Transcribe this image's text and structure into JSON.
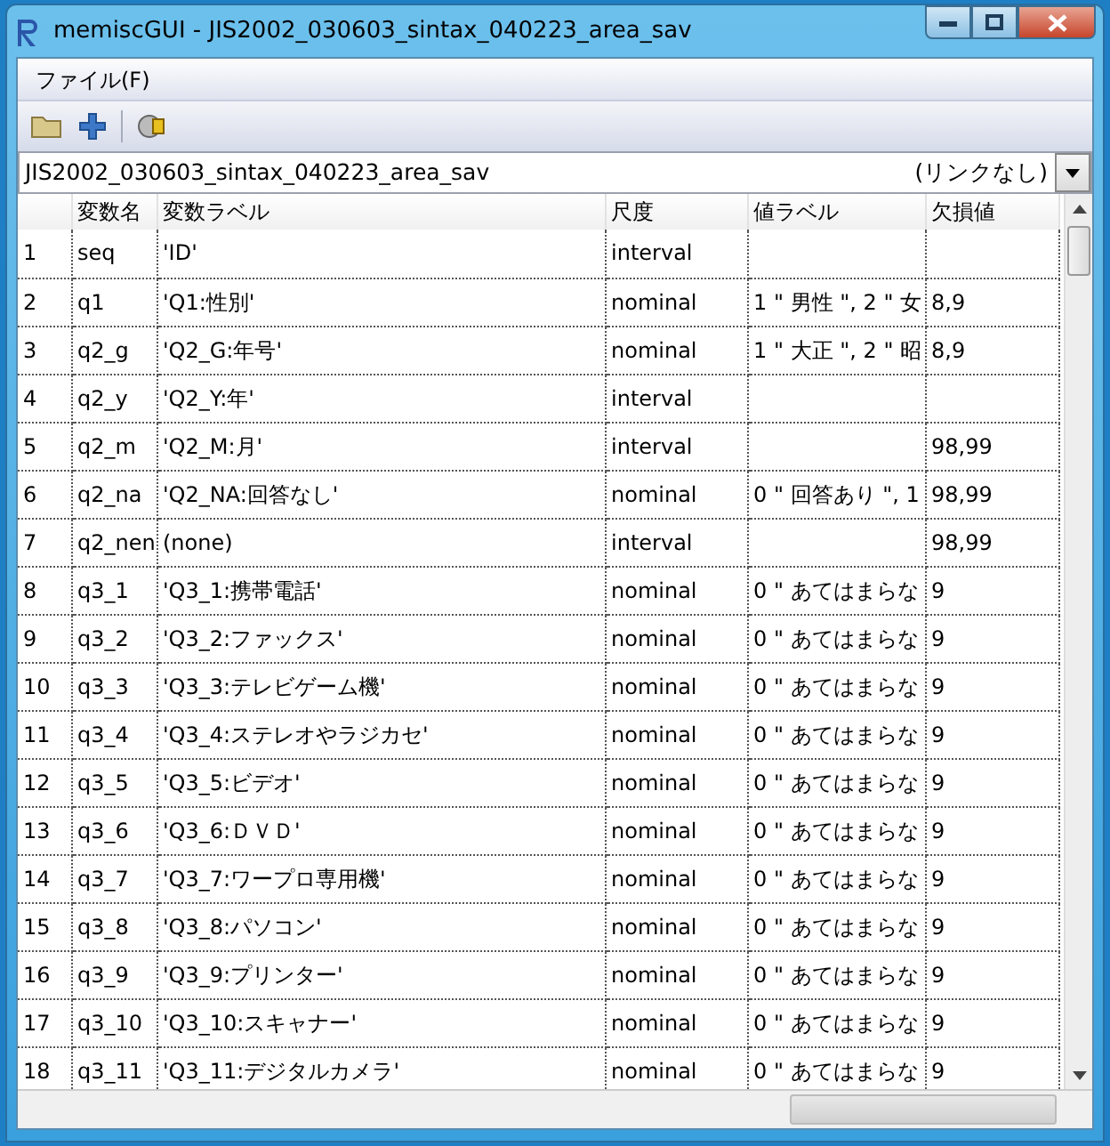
{
  "window": {
    "title": "memiscGUI - JIS2002_030603_sintax_040223_area_sav"
  },
  "menu": [
    {
      "label": "ファイル(F)"
    }
  ],
  "dataset_selector": {
    "value": "JIS2002_030603_sintax_040223_area_sav",
    "link_status": "(リンクなし)"
  },
  "table": {
    "columns": [
      "変数名",
      "変数ラベル",
      "尺度",
      "値ラベル",
      "欠損値"
    ],
    "rows": [
      {
        "number": "1",
        "name": "seq",
        "label": "'ID'",
        "scale": "interval",
        "value_labels": "",
        "missing": ""
      },
      {
        "number": "2",
        "name": "q1",
        "label": "'Q1:性別'",
        "scale": "nominal",
        "value_labels": "1 \" 男性 \", 2 \" 女",
        "missing": "8,9"
      },
      {
        "number": "3",
        "name": "q2_g",
        "label": "'Q2_G:年号'",
        "scale": "nominal",
        "value_labels": "1 \" 大正 \", 2 \" 昭",
        "missing": "8,9"
      },
      {
        "number": "4",
        "name": "q2_y",
        "label": "'Q2_Y:年'",
        "scale": "interval",
        "value_labels": "",
        "missing": ""
      },
      {
        "number": "5",
        "name": "q2_m",
        "label": "'Q2_M:月'",
        "scale": "interval",
        "value_labels": "",
        "missing": "98,99"
      },
      {
        "number": "6",
        "name": "q2_na",
        "label": "'Q2_NA:回答なし'",
        "scale": "nominal",
        "value_labels": "0 \" 回答あり \", 1",
        "missing": "98,99"
      },
      {
        "number": "7",
        "name": "q2_nen",
        "label": " (none)",
        "scale": "interval",
        "value_labels": "",
        "missing": "98,99"
      },
      {
        "number": "8",
        "name": "q3_1",
        "label": "'Q3_1:携帯電話'",
        "scale": "nominal",
        "value_labels": "0 \" あてはまらな",
        "missing": "9"
      },
      {
        "number": "9",
        "name": "q3_2",
        "label": "'Q3_2:ファックス'",
        "scale": "nominal",
        "value_labels": "0 \" あてはまらな",
        "missing": "9"
      },
      {
        "number": "10",
        "name": "q3_3",
        "label": "'Q3_3:テレビゲーム機'",
        "scale": "nominal",
        "value_labels": "0 \" あてはまらな",
        "missing": "9"
      },
      {
        "number": "11",
        "name": "q3_4",
        "label": "'Q3_4:ステレオやラジカセ'",
        "scale": "nominal",
        "value_labels": "0 \" あてはまらな",
        "missing": "9"
      },
      {
        "number": "12",
        "name": "q3_5",
        "label": "'Q3_5:ビデオ'",
        "scale": "nominal",
        "value_labels": "0 \" あてはまらな",
        "missing": "9"
      },
      {
        "number": "13",
        "name": "q3_6",
        "label": "'Q3_6:ＤＶＤ'",
        "scale": "nominal",
        "value_labels": "0 \" あてはまらな",
        "missing": "9"
      },
      {
        "number": "14",
        "name": "q3_7",
        "label": "'Q3_7:ワープロ専用機'",
        "scale": "nominal",
        "value_labels": "0 \" あてはまらな",
        "missing": "9"
      },
      {
        "number": "15",
        "name": "q3_8",
        "label": "'Q3_8:パソコン'",
        "scale": "nominal",
        "value_labels": "0 \" あてはまらな",
        "missing": "9"
      },
      {
        "number": "16",
        "name": "q3_9",
        "label": "'Q3_9:プリンター'",
        "scale": "nominal",
        "value_labels": "0 \" あてはまらな",
        "missing": "9"
      },
      {
        "number": "17",
        "name": "q3_10",
        "label": "'Q3_10:スキャナー'",
        "scale": "nominal",
        "value_labels": "0 \" あてはまらな",
        "missing": "9"
      },
      {
        "number": "18",
        "name": "q3_11",
        "label": "'Q3_11:デジタルカメラ'",
        "scale": "nominal",
        "value_labels": "0 \" あてはまらな",
        "missing": "9"
      }
    ]
  }
}
